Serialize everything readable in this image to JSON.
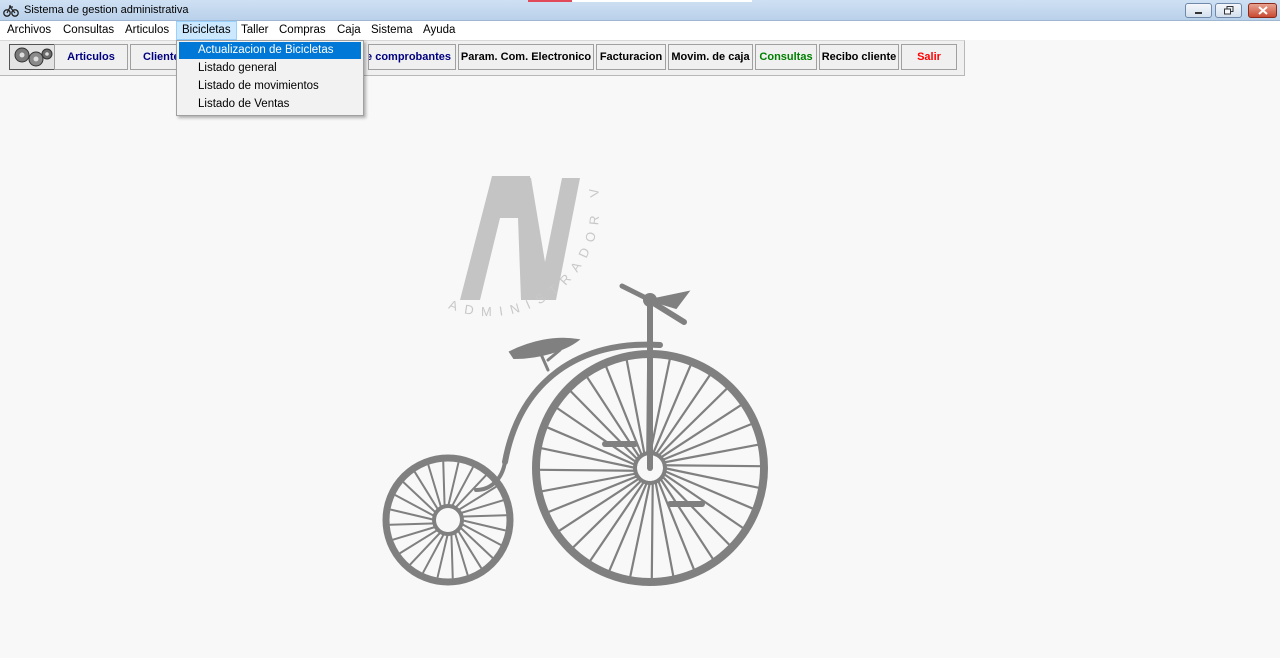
{
  "window": {
    "title": "Sistema de gestion administrativa",
    "app_icon": "bicycle-icon",
    "controls": [
      "minimize-icon",
      "restore-icon",
      "close-icon"
    ]
  },
  "menubar": {
    "items": [
      {
        "label": "Archivos"
      },
      {
        "label": "Consultas"
      },
      {
        "label": "Articulos"
      },
      {
        "label": "Bicicletas"
      },
      {
        "label": "Taller"
      },
      {
        "label": "Compras"
      },
      {
        "label": "Caja"
      },
      {
        "label": "Sistema"
      },
      {
        "label": "Ayuda"
      }
    ],
    "open_menu": "Bicicletas"
  },
  "toolbar": {
    "image_icon": "gears-icon",
    "buttons": [
      {
        "label": "Articulos",
        "color": "#000080"
      },
      {
        "label": "Clientes",
        "color": "#000080"
      },
      {
        "label": "de comprobantes",
        "color": "#000080"
      },
      {
        "label": "Param. Com. Electronico",
        "color": "#000000"
      },
      {
        "label": "Facturacion",
        "color": "#000000"
      },
      {
        "label": "Movim. de caja",
        "color": "#000000"
      },
      {
        "label": "Consultas",
        "color": "#008000"
      },
      {
        "label": "Recibo cliente",
        "color": "#000000"
      },
      {
        "label": "Salir",
        "color": "#ff0000"
      }
    ]
  },
  "dropdown": {
    "items": [
      {
        "label": "Actualizacion de Bicicletas",
        "selected": true
      },
      {
        "label": "Listado general",
        "selected": false
      },
      {
        "label": "Listado de movimientos",
        "selected": false
      },
      {
        "label": "Listado de Ventas",
        "selected": false
      }
    ],
    "highlight_color": "#0078d7"
  },
  "logo": {
    "monogram": "AV",
    "arc_text": "ADMINISTRADOR VELO",
    "icon": "penny-farthing-bicycle-icon"
  }
}
